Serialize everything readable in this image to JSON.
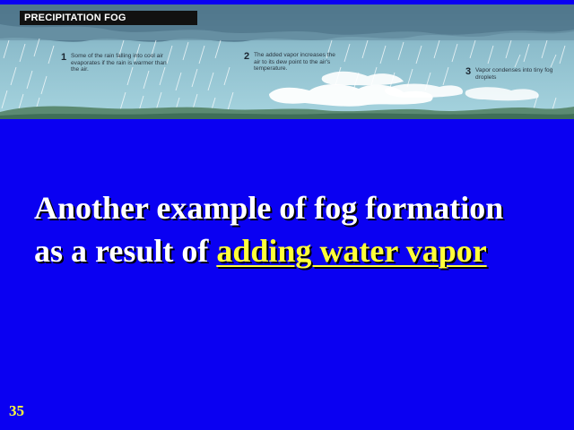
{
  "figure": {
    "title": "PRECIPITATION FOG",
    "steps": [
      {
        "number": "1",
        "text": "Some of the rain falling into cool air evaporates if the rain is warmer than the air."
      },
      {
        "number": "2",
        "text": "The added vapor increases the air to its dew point to the air's temperature."
      },
      {
        "number": "3",
        "text": "Vapor condenses into tiny fog droplets"
      }
    ]
  },
  "message": {
    "line1": "Another example of fog formation",
    "line2_prefix": "as a result of ",
    "line2_highlight": "adding water vapor"
  },
  "page_number": "35",
  "colors": {
    "background": "#0a00f2",
    "text": "#ffffff",
    "highlight": "#ffff3a"
  }
}
